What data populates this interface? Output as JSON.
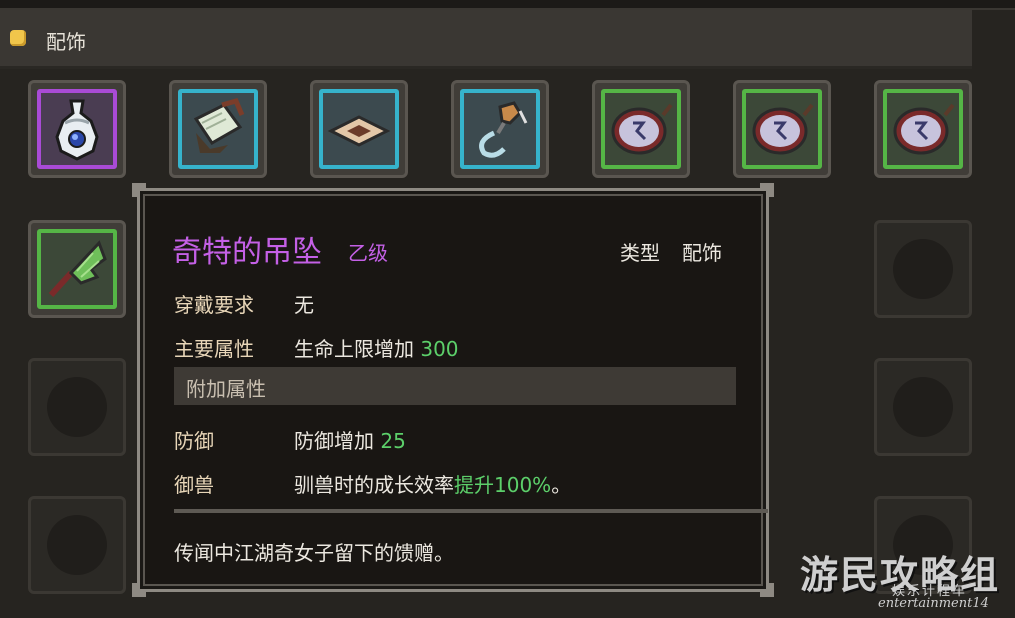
{
  "header": {
    "title": "配饰"
  },
  "tooltip": {
    "name": "奇特的吊坠",
    "grade": "乙级",
    "type_label": "类型",
    "type_value": "配饰",
    "requirement_label": "穿戴要求",
    "requirement_value": "无",
    "main_attr_label": "主要属性",
    "main_attr_text": "生命上限增加",
    "main_attr_num": "300",
    "extra_section": "附加属性",
    "defense_label": "防御",
    "defense_text": "防御增加",
    "defense_num": "25",
    "taming_label": "御兽",
    "taming_text": "驯兽时的成长效率",
    "taming_highlight": "提升100%",
    "taming_suffix": "。",
    "description": "传闻中江湖奇女子留下的馈赠。"
  },
  "watermark": {
    "main": "游民攻略组",
    "sub": "娱乐计程车",
    "en": "entertainment14"
  },
  "colors": {
    "purple": "#a94bd6",
    "blue": "#36b3cc",
    "green": "#55b546",
    "highlight": "#5ccf6a"
  }
}
